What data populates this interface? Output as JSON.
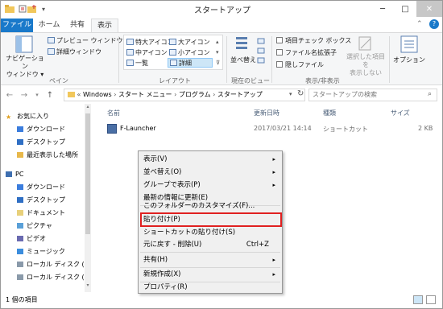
{
  "window": {
    "title": "スタートアップ",
    "minimize": "─",
    "maximize": "□",
    "close": "✕"
  },
  "tabs": [
    "ファイル",
    "ホーム",
    "共有",
    "表示"
  ],
  "ribbon": {
    "nav_pane": {
      "label": "ナビゲーション\nウィンドウ ▾"
    },
    "preview_pane": "プレビュー ウィンドウ",
    "details_pane": "詳細ウィンドウ",
    "panes_group": "ペイン",
    "layout": [
      "特大アイコン",
      "大アイコン",
      "中アイコン",
      "小アイコン",
      "一覧",
      "詳細"
    ],
    "layout_group": "レイアウト",
    "sort": "並べ替え",
    "current_view_group": "現在のビュー",
    "item_checkboxes": "項目チェック ボックス",
    "file_extensions": "ファイル名拡張子",
    "hidden_items": "隠しファイル",
    "hide_selected": "選択した項目を\n表示しない",
    "show_hide_group": "表示/非表示",
    "options": "オプション"
  },
  "address": {
    "path": [
      "Windows",
      "スタート メニュー",
      "プログラム",
      "スタートアップ"
    ],
    "search_placeholder": "スタートアップの検索"
  },
  "navpane": {
    "items": [
      "お気に入り",
      "ダウンロード",
      "デスクトップ",
      "最近表示した場所",
      "PC",
      "ダウンロード",
      "デスクトップ",
      "ドキュメント",
      "ピクチャ",
      "ビデオ",
      "ミュージック",
      "ローカル ディスク (C",
      "ローカル ディスク (D"
    ]
  },
  "columns": [
    "名前",
    "更新日時",
    "種類",
    "サイズ"
  ],
  "files": [
    {
      "name": "F-Launcher",
      "modified": "2017/03/21 14:14",
      "type": "ショートカット",
      "size": "2 KB"
    }
  ],
  "status": {
    "count": "1 個の項目"
  },
  "context_menu": {
    "items": [
      {
        "label": "表示(V)",
        "arrow": "▸"
      },
      {
        "label": "並べ替え(O)",
        "arrow": "▸"
      },
      {
        "label": "グループで表示(P)",
        "arrow": "▸"
      },
      {
        "label": "最新の情報に更新(E)"
      },
      {
        "label": "このフォルダーのカスタマイズ(F)..."
      },
      {
        "label": "貼り付け(P)"
      },
      {
        "label": "ショートカットの貼り付け(S)"
      },
      {
        "label": "元に戻す - 削除(U)",
        "shortcut": "Ctrl+Z"
      },
      {
        "label": "共有(H)",
        "arrow": "▸"
      },
      {
        "label": "新規作成(X)",
        "arrow": "▸"
      },
      {
        "label": "プロパティ(R)"
      }
    ]
  },
  "colors": {
    "accent": "#1979ca",
    "highlight": "#e02020"
  }
}
